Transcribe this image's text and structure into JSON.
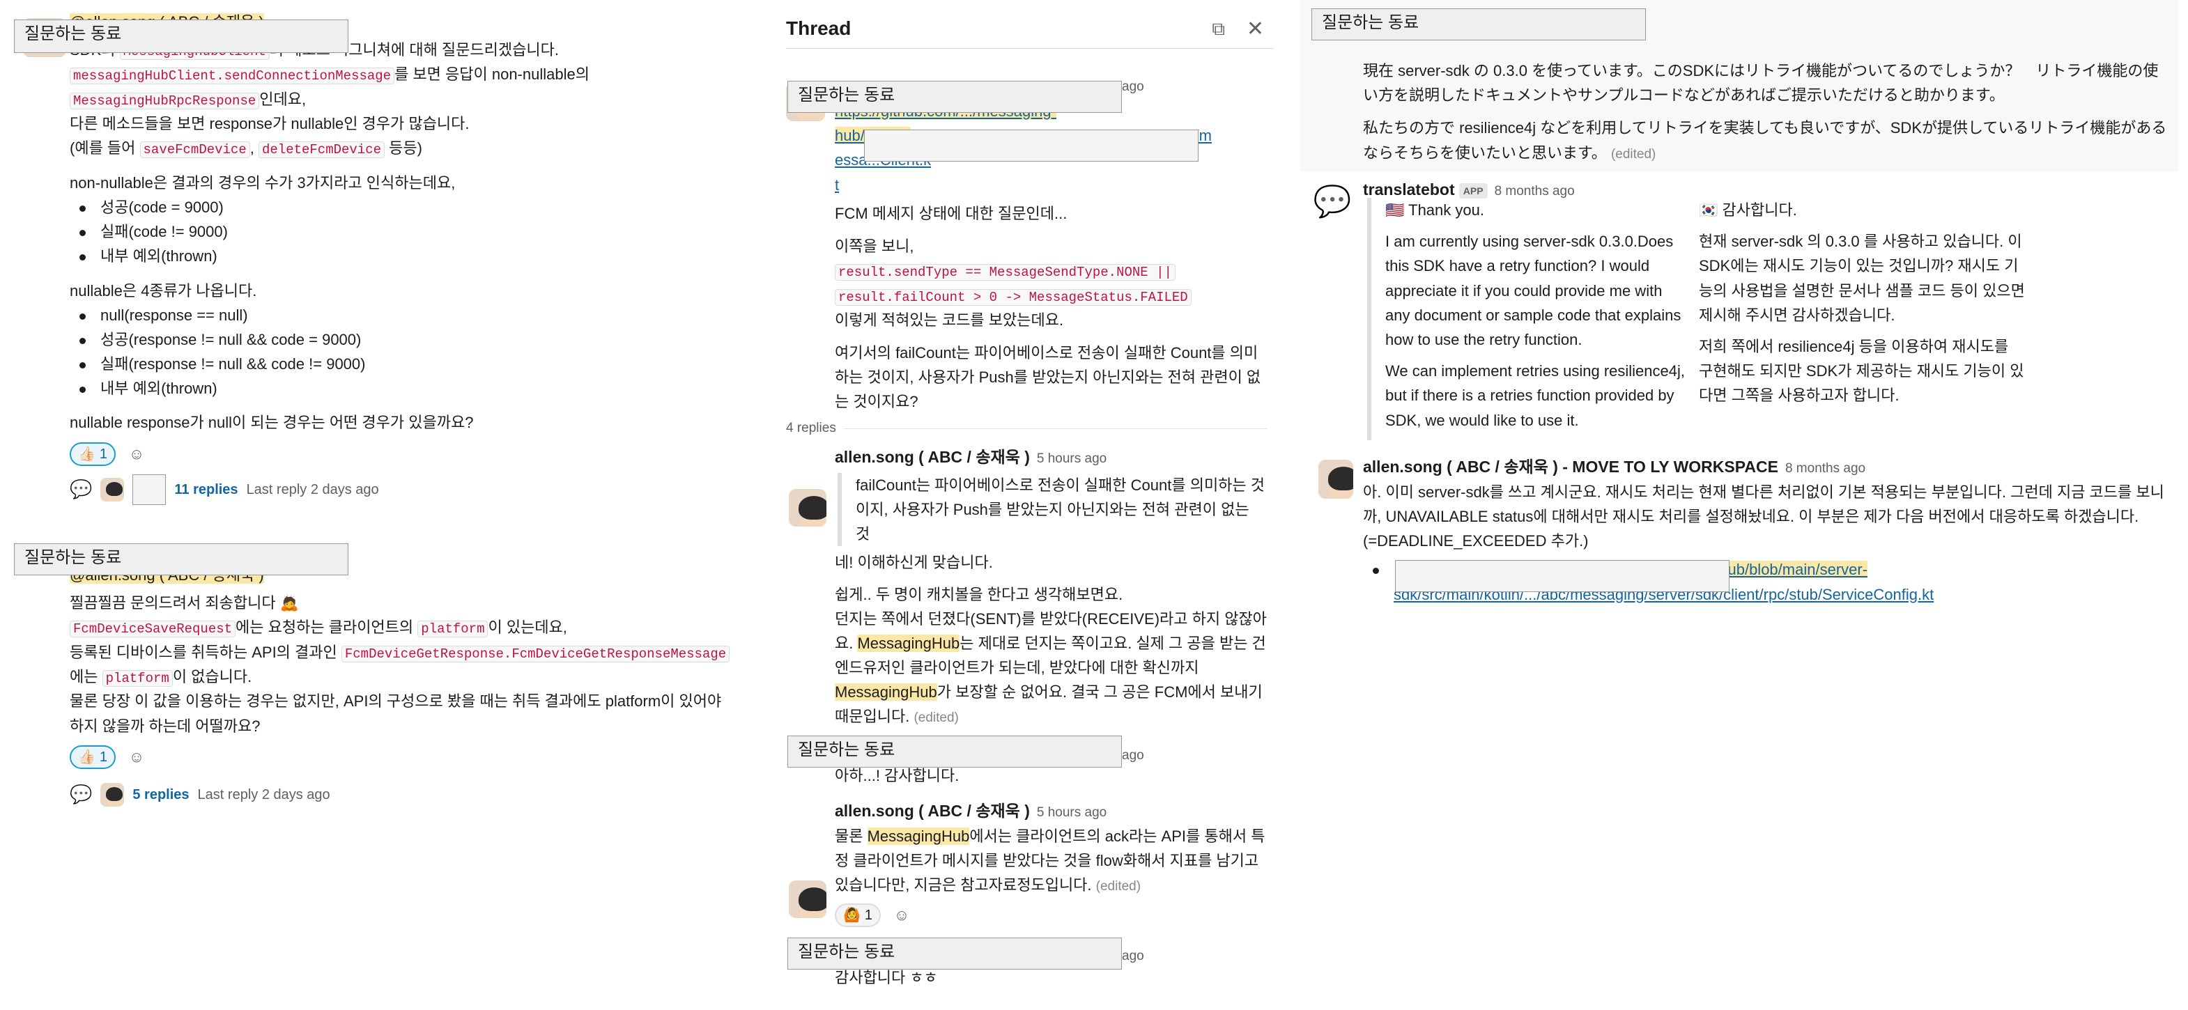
{
  "masks": {
    "label": "질문하는 동료"
  },
  "left": {
    "msg1": {
      "author_partial": "@allen.song ( ABC / 송재욱 )",
      "l1_a": "SDK의 ",
      "l1_code": "MessagingHubClient",
      "l1_b": "의 메소드 시그니쳐에 대해 질문드리겠습니다.",
      "l2_code": "messagingHubClient.sendConnectionMessage",
      "l2_b": "를 보면 응답이 non-nullable의",
      "l3_code": "MessagingHubRpcResponse",
      "l3_b": "인데요,",
      "l4": "다른 메소드들을 보면 response가 nullable인 경우가 많습니다.",
      "l5_a": "(예를 들어 ",
      "l5_code1": "saveFcmDevice",
      "l5_sep": ", ",
      "l5_code2": "deleteFcmDevice",
      "l5_b": " 등등)",
      "p2": "non-nullable은 결과의 경우의 수가 3가지라고 인식하는데요,",
      "list1": [
        "성공(code = 9000)",
        "실패(code != 9000)",
        "내부 예외(thrown)"
      ],
      "p3": "nullable은 4종류가 나옵니다.",
      "list2": [
        "null(response == null)",
        "성공(response != null && code = 9000)",
        "실패(response != null && code != 9000)",
        "내부 예외(thrown)"
      ],
      "p4": "nullable response가 null이 되는 경우는 어떤 경우가 있을까요?",
      "reaction_emoji": "👍🏻",
      "reaction_count": "1",
      "replies": "11 replies",
      "last_reply": "Last reply 2 days ago"
    },
    "msg2": {
      "author_partial": "@allen.song ( ABC / 송재욱 )",
      "l1": "찔끔찔끔 문의드려서 죄송합니다 🙇",
      "l2_code": "FcmDeviceSaveRequest",
      "l2_b": "에는 요청하는 클라이언트의 ",
      "l2_code2": "platform",
      "l2_c": "이 있는데요,",
      "l3_a": "등록된 디바이스를 취득하는 API의 결과인 ",
      "l3_code": "FcmDeviceGetResponse.FcmDeviceGetResponseMessage",
      "l4_a": "에는 ",
      "l4_code": "platform",
      "l4_b": "이 없습니다.",
      "l5": "물론 당장 이 값을 이용하는 경우는 없지만, API의 구성으로 봤을 때는 취득 결과에도 platform이 있어야",
      "l6": "하지 않을까 하는데 어떨까요?",
      "reaction_emoji": "👍🏻",
      "reaction_count": "1",
      "replies": "5 replies",
      "last_reply": "Last reply 2 days ago"
    }
  },
  "thread": {
    "title": "Thread",
    "root": {
      "time": "ago",
      "link_l1": "https://github.com/.../messaging-",
      "link_l2": "hub/blob/...",
      "link_l2b": "...]bc/m",
      "link_l3": "essa...Client.k",
      "link_l4": "t",
      "p1": "FCM 메세지 상태에 대한 질문인데...",
      "p2": "이쪽을 보니,",
      "code1": "result.sendType == MessageSendType.NONE ||",
      "code2": "result.failCount > 0 -> MessageStatus.FAILED",
      "p3": "이렇게 적혀있는 코드를 보았는데요.",
      "p4": "여기서의 failCount는 파이어베이스로 전송이 실패한 Count를 의미하는 것이지, 사용자가 Push를 받았는지 아닌지와는 전혀 관련이 없는 것이지요?"
    },
    "replies_count": "4 replies",
    "reply1": {
      "author": "allen.song ( ABC / 송재욱 )",
      "time": "5 hours ago",
      "quote": "failCount는 파이어베이스로 전송이 실패한 Count를 의미하는 것이지, 사용자가 Push를 받았는지 아닌지와는 전혀 관련이 없는 것",
      "p1": "네! 이해하신게 맞습니다.",
      "p2_a": "쉽게.. 두 명이 캐치볼을 한다고 생각해보면요.",
      "p2_b": "던지는 쪽에서 던졌다(SENT)를 받았다(RECEIVE)라고 하지 않잖아요. ",
      "hl1": "MessagingHub",
      "p2_c": "는 제대로 던지는 쪽이고요. 실제 그 공을 받는 건 엔드유저인 클라이언트가 되는데, 받았다에 대한 확신까지 ",
      "hl2": "MessagingHub",
      "p2_d": "가 보장할 순 없어요. 결국 그 공은 FCM에서 보내기 때문입니다.",
      "edited": "(edited)"
    },
    "reply2": {
      "time": "ago",
      "text": "아하...! 감사합니다."
    },
    "reply3": {
      "author": "allen.song ( ABC / 송재욱 )",
      "time": "5 hours ago",
      "a": "물론 ",
      "hl": "MessagingHub",
      "b": "에서는 클라이언트의 ack라는 API를 통해서 특정 클라이언트가 메시지를 받았다는 것을 flow화해서 지표를 남기고 있습니다만, 지금은 참고자료정도입니다.",
      "edited": "(edited)",
      "reaction_emoji": "🙆",
      "reaction_count": "1"
    },
    "reply4": {
      "time": "ago",
      "text": "감사합니다 ㅎㅎ"
    }
  },
  "right": {
    "top": {
      "p1": "現在 server-sdk の 0.3.0 を使っています。このSDKにはリトライ機能がついてるのでしょうか？　リトライ機能の使い方を説明したドキュメントやサンプルコードなどがあればご提示いただけると助かります。",
      "p2": "私たちの方で resilience4j などを利用してリトライを実装しても良いですが、SDKが提供しているリトライ機能があるならそちらを使いたいと思います。",
      "edited": "(edited)"
    },
    "translatebot": {
      "name": "translatebot",
      "badge": "APP",
      "time": "8 months ago",
      "en_flag": "🇺🇸",
      "en_head": "Thank you.",
      "en_p1": "I am currently using server-sdk 0.3.0.Does this SDK have a retry function? I would appreciate it if you could provide me with any document or sample code that explains how to use the retry function.",
      "en_p2": "We can implement retries using resilience4j, but if there is a retries function provided by SDK, we would like to use it.",
      "ko_flag": "🇰🇷",
      "ko_head": "감사합니다.",
      "ko_p1": "현재 server-sdk 의 0.3.0 를 사용하고 있습니다. 이 SDK에는 재시도 기능이 있는 것입니까? 재시도 기능의 사용법을 설명한 문서나 샘플 코드 등이 있으면 제시해 주시면 감사하겠습니다.",
      "ko_p2": "저희 쪽에서 resilience4j 등을 이용하여 재시도를 구현해도 되지만 SDK가 제공하는 재시도 기능이 있다면 그쪽을 사용하고자 합니다."
    },
    "allen": {
      "name": "allen.song ( ABC / 송재욱 ) - MOVE TO LY WORKSPACE",
      "time": "8 months ago",
      "text": "아. 이미 server-sdk를 쓰고 계시군요. 재시도 처리는 현재 별다른 처리없이 기본 적용되는 부분입니다. 그런데 지금 코드를 보니까, UNAVAILABLE status에 대해서만 재시도 처리를 설정해놨네요. 이 부분은 제가 다음 버전에서 대응하도록 하겠습니다. (=DEADLINE_EXCEEDED 추가.)",
      "link_l1": "...ging-hub/blob/main/server-",
      "link_l2": "sdk/src/main/kotlin/.../abc/messaging/server/sdk/client/rpc/stub/ServiceConfig.kt"
    }
  }
}
